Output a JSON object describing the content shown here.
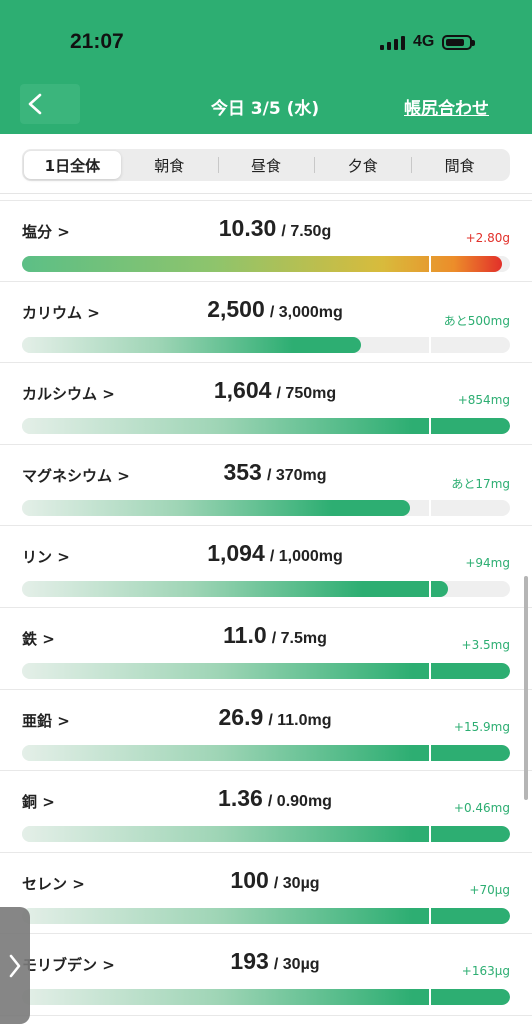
{
  "status": {
    "time": "21:07",
    "network": "4G"
  },
  "nav": {
    "title": "今日 3/5 (水)",
    "right_link": "帳尻合わせ"
  },
  "tabs": [
    {
      "label": "1日全体",
      "active": true
    },
    {
      "label": "朝食",
      "active": false
    },
    {
      "label": "昼食",
      "active": false
    },
    {
      "label": "夕食",
      "active": false
    },
    {
      "label": "間食",
      "active": false
    }
  ],
  "nutrients": [
    {
      "name": "塩分 >",
      "value": "10.30",
      "target": "/ 7.50g",
      "diff": "+2.80g",
      "progress": 1.37,
      "style": "salt"
    },
    {
      "name": "カリウム >",
      "value": "2,500",
      "target": "/ 3,000mg",
      "diff": "あと500mg",
      "progress": 0.83,
      "style": "normal"
    },
    {
      "name": "カルシウム >",
      "value": "1,604",
      "target": "/ 750mg",
      "diff": "+854mg",
      "progress": 2.14,
      "style": "normal"
    },
    {
      "name": "マグネシウム >",
      "value": "353",
      "target": "/ 370mg",
      "diff": "あと17mg",
      "progress": 0.95,
      "style": "normal"
    },
    {
      "name": "リン >",
      "value": "1,094",
      "target": "/ 1,000mg",
      "diff": "+94mg",
      "progress": 1.09,
      "style": "normal"
    },
    {
      "name": "鉄 >",
      "value": "11.0",
      "target": "/ 7.5mg",
      "diff": "+3.5mg",
      "progress": 1.47,
      "style": "normal"
    },
    {
      "name": "亜鉛 >",
      "value": "26.9",
      "target": "/ 11.0mg",
      "diff": "+15.9mg",
      "progress": 2.45,
      "style": "normal"
    },
    {
      "name": "銅 >",
      "value": "1.36",
      "target": "/ 0.90mg",
      "diff": "+0.46mg",
      "progress": 1.51,
      "style": "normal"
    },
    {
      "name": "セレン >",
      "value": "100",
      "target": "/ 30µg",
      "diff": "+70µg",
      "progress": 3.33,
      "style": "normal"
    },
    {
      "name": "モリブデン >",
      "value": "193",
      "target": "/ 30µg",
      "diff": "+163µg",
      "progress": 6.43,
      "style": "normal"
    }
  ],
  "colors": {
    "brand": "#2dae72",
    "over": "#e2302a"
  }
}
